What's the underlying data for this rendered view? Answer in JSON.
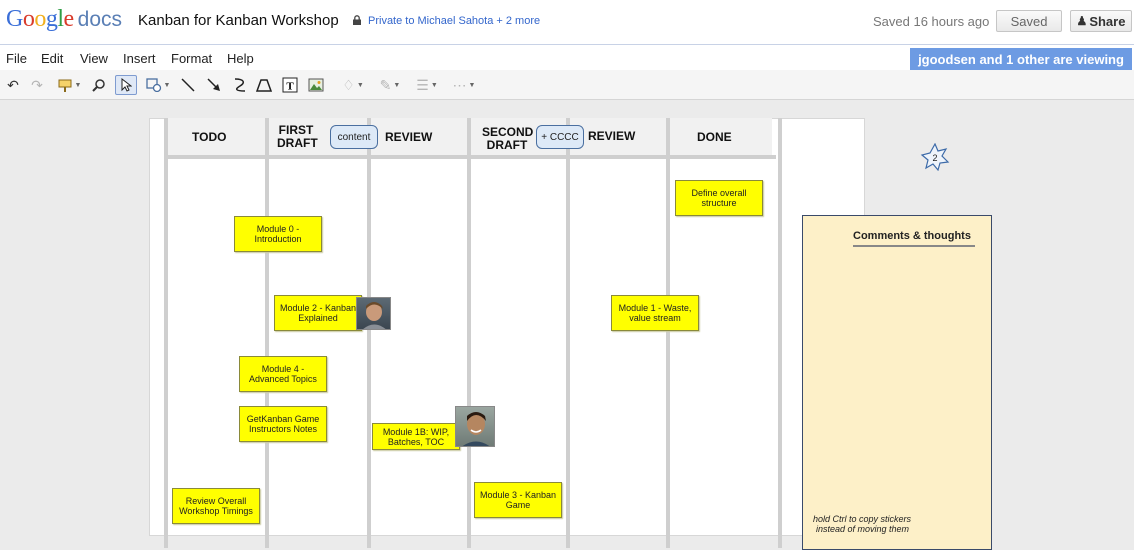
{
  "header": {
    "logo_google": "Google",
    "logo_docs": "docs",
    "title": "Kanban for Kanban Workshop",
    "privacy": "Private to Michael Sahota + 2 more",
    "saved_status": "Saved 16 hours ago",
    "saved_button": "Saved",
    "share_button": "Share"
  },
  "menu": {
    "file": "File",
    "edit": "Edit",
    "view": "View",
    "insert": "Insert",
    "format": "Format",
    "help": "Help"
  },
  "viewers": "jgoodsen and 1 other are viewing",
  "toolbar": {
    "icons": [
      "undo-icon",
      "redo-icon",
      "paint-format-icon",
      "zoom-icon",
      "select-icon",
      "shape-icon",
      "line-icon",
      "arrow-icon",
      "curve-icon",
      "polyline-icon",
      "text-box-icon",
      "image-icon",
      "fill-color-icon",
      "line-color-icon",
      "line-weight-icon",
      "line-dash-icon"
    ]
  },
  "board": {
    "columns": {
      "todo": "TODO",
      "first_draft_1": "FIRST",
      "first_draft_2": "DRAFT",
      "review1": "REVIEW",
      "second_draft_1": "SECOND",
      "second_draft_2": "DRAFT",
      "review2": "REVIEW",
      "done": "DONE"
    },
    "chips": {
      "content": "content",
      "cccc": "+ CCCC"
    },
    "stickies": {
      "module0": "Module 0 - Introduction",
      "module2": "Module 2  - Kanban Explained",
      "module4": "Module 4  - Advanced Topics",
      "getkanban": "GetKanban Game Instructors Notes",
      "review_timings": "Review Overall Workshop Timings",
      "module1b": "Module 1B: WIP, Batches, TOC",
      "module3": "Module 3  - Kanban Game",
      "module1": "Module 1 - Waste, value stream",
      "define_structure": "Define overall structure"
    },
    "star_badge": "2"
  },
  "comments": {
    "title": "Comments & thoughts",
    "hint_line1": "hold Ctrl to copy stickers",
    "hint_line2": "instead of moving them"
  }
}
